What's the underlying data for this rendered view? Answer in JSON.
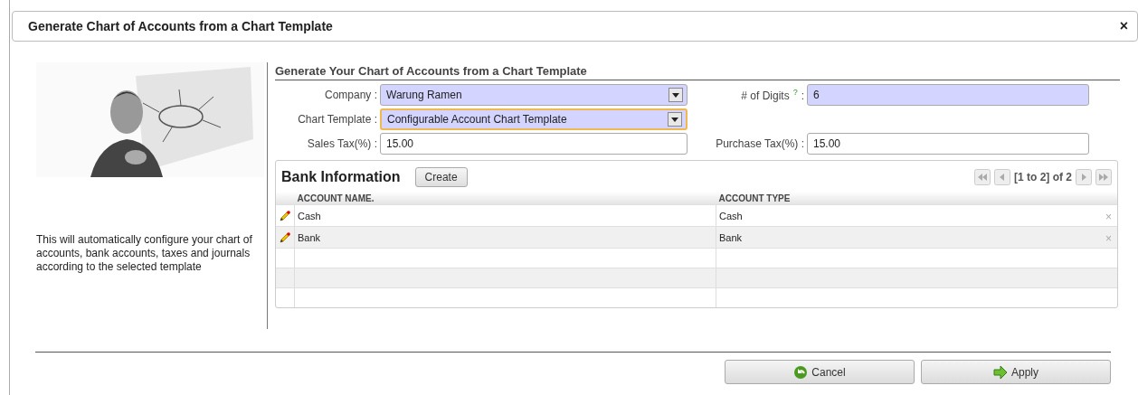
{
  "dialog": {
    "title": "Generate Chart of Accounts from a Chart Template",
    "close": "×"
  },
  "picture": {
    "kind": "picture"
  },
  "description": "This will automatically configure your chart of accounts, bank accounts, taxes and journals according to the selected template",
  "section_title": "Generate Your Chart of Accounts from a Chart Template",
  "form_rows": [
    [
      {
        "label": "Company :",
        "value": "Warung Ramen",
        "kind": "select",
        "required": true,
        "focused": false
      },
      {
        "label": "# of Digits",
        "help": "?",
        "suffix": ":",
        "value": "6",
        "kind": "text",
        "required": true,
        "focused": false
      }
    ],
    [
      {
        "label": "Chart Template :",
        "value": "Configurable Account Chart Template",
        "kind": "select",
        "required": true,
        "focused": true
      }
    ],
    [
      {
        "label": "Sales Tax(%) :",
        "value": "15.00",
        "kind": "text",
        "required": false,
        "focused": false
      },
      {
        "label": "Purchase Tax(%) :",
        "value": "15.00",
        "kind": "text",
        "required": false,
        "focused": false
      }
    ]
  ],
  "bank": {
    "title": "Bank Information",
    "create": "Create",
    "pager": "[1 to 2] of 2",
    "columns": [
      "ACCOUNT NAME.",
      "ACCOUNT TYPE"
    ],
    "rows": [
      {
        "name": "Cash",
        "type": "Cash",
        "delete": "×"
      },
      {
        "name": "Bank",
        "type": "Bank",
        "delete": "×"
      }
    ]
  },
  "buttons": [
    {
      "label": "Cancel",
      "kind": "cancel"
    },
    {
      "label": "Apply",
      "kind": "apply"
    }
  ]
}
